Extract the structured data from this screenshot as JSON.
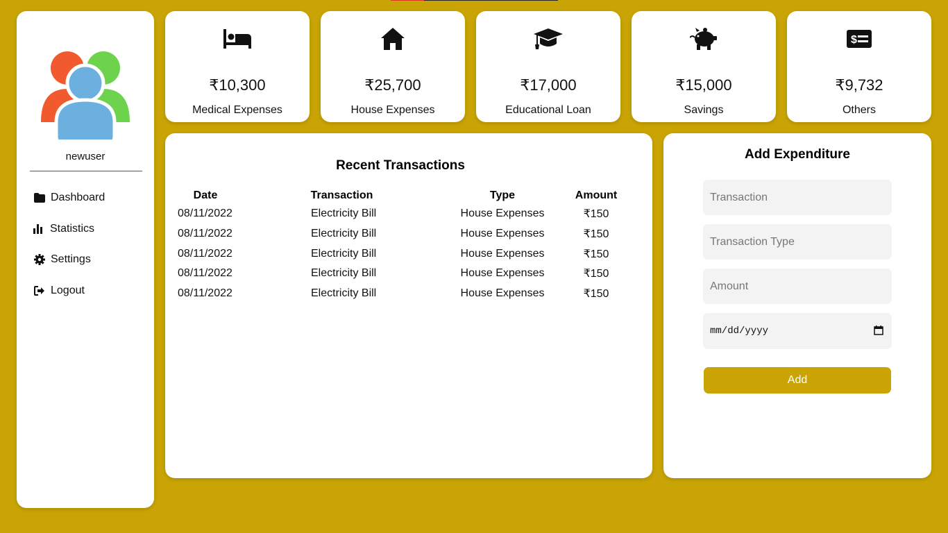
{
  "sidebar": {
    "username": "newuser",
    "items": [
      {
        "label": "Dashboard",
        "icon": "folder-icon"
      },
      {
        "label": "Statistics",
        "icon": "bar-chart-icon"
      },
      {
        "label": "Settings",
        "icon": "gear-icon"
      },
      {
        "label": "Logout",
        "icon": "logout-icon"
      }
    ]
  },
  "cards": [
    {
      "amount": "₹10,300",
      "label": "Medical Expenses",
      "icon": "bed-icon"
    },
    {
      "amount": "₹25,700",
      "label": "House Expenses",
      "icon": "home-icon"
    },
    {
      "amount": "₹17,000",
      "label": "Educational Loan",
      "icon": "graduation-cap-icon"
    },
    {
      "amount": "₹15,000",
      "label": "Savings",
      "icon": "piggy-bank-icon"
    },
    {
      "amount": "₹9,732",
      "label": "Others",
      "icon": "money-check-icon"
    }
  ],
  "transactions": {
    "title": "Recent Transactions",
    "headers": [
      "Date",
      "Transaction",
      "Type",
      "Amount"
    ],
    "rows": [
      [
        "08/11/2022",
        "Electricity Bill",
        "House Expenses",
        "₹150"
      ],
      [
        "08/11/2022",
        "Electricity Bill",
        "House Expenses",
        "₹150"
      ],
      [
        "08/11/2022",
        "Electricity Bill",
        "House Expenses",
        "₹150"
      ],
      [
        "08/11/2022",
        "Electricity Bill",
        "House Expenses",
        "₹150"
      ],
      [
        "08/11/2022",
        "Electricity Bill",
        "House Expenses",
        "₹150"
      ]
    ]
  },
  "form": {
    "title": "Add Expenditure",
    "transaction_placeholder": "Transaction",
    "type_placeholder": "Transaction Type",
    "amount_placeholder": "Amount",
    "date_placeholder": "mm/dd/yyyy",
    "add_label": "Add"
  },
  "colors": {
    "background": "#c9a404",
    "accent": "#c9a404",
    "avatar_left": "#f05a2e",
    "avatar_right": "#6dd34d",
    "avatar_center": "#6cb0e0"
  }
}
